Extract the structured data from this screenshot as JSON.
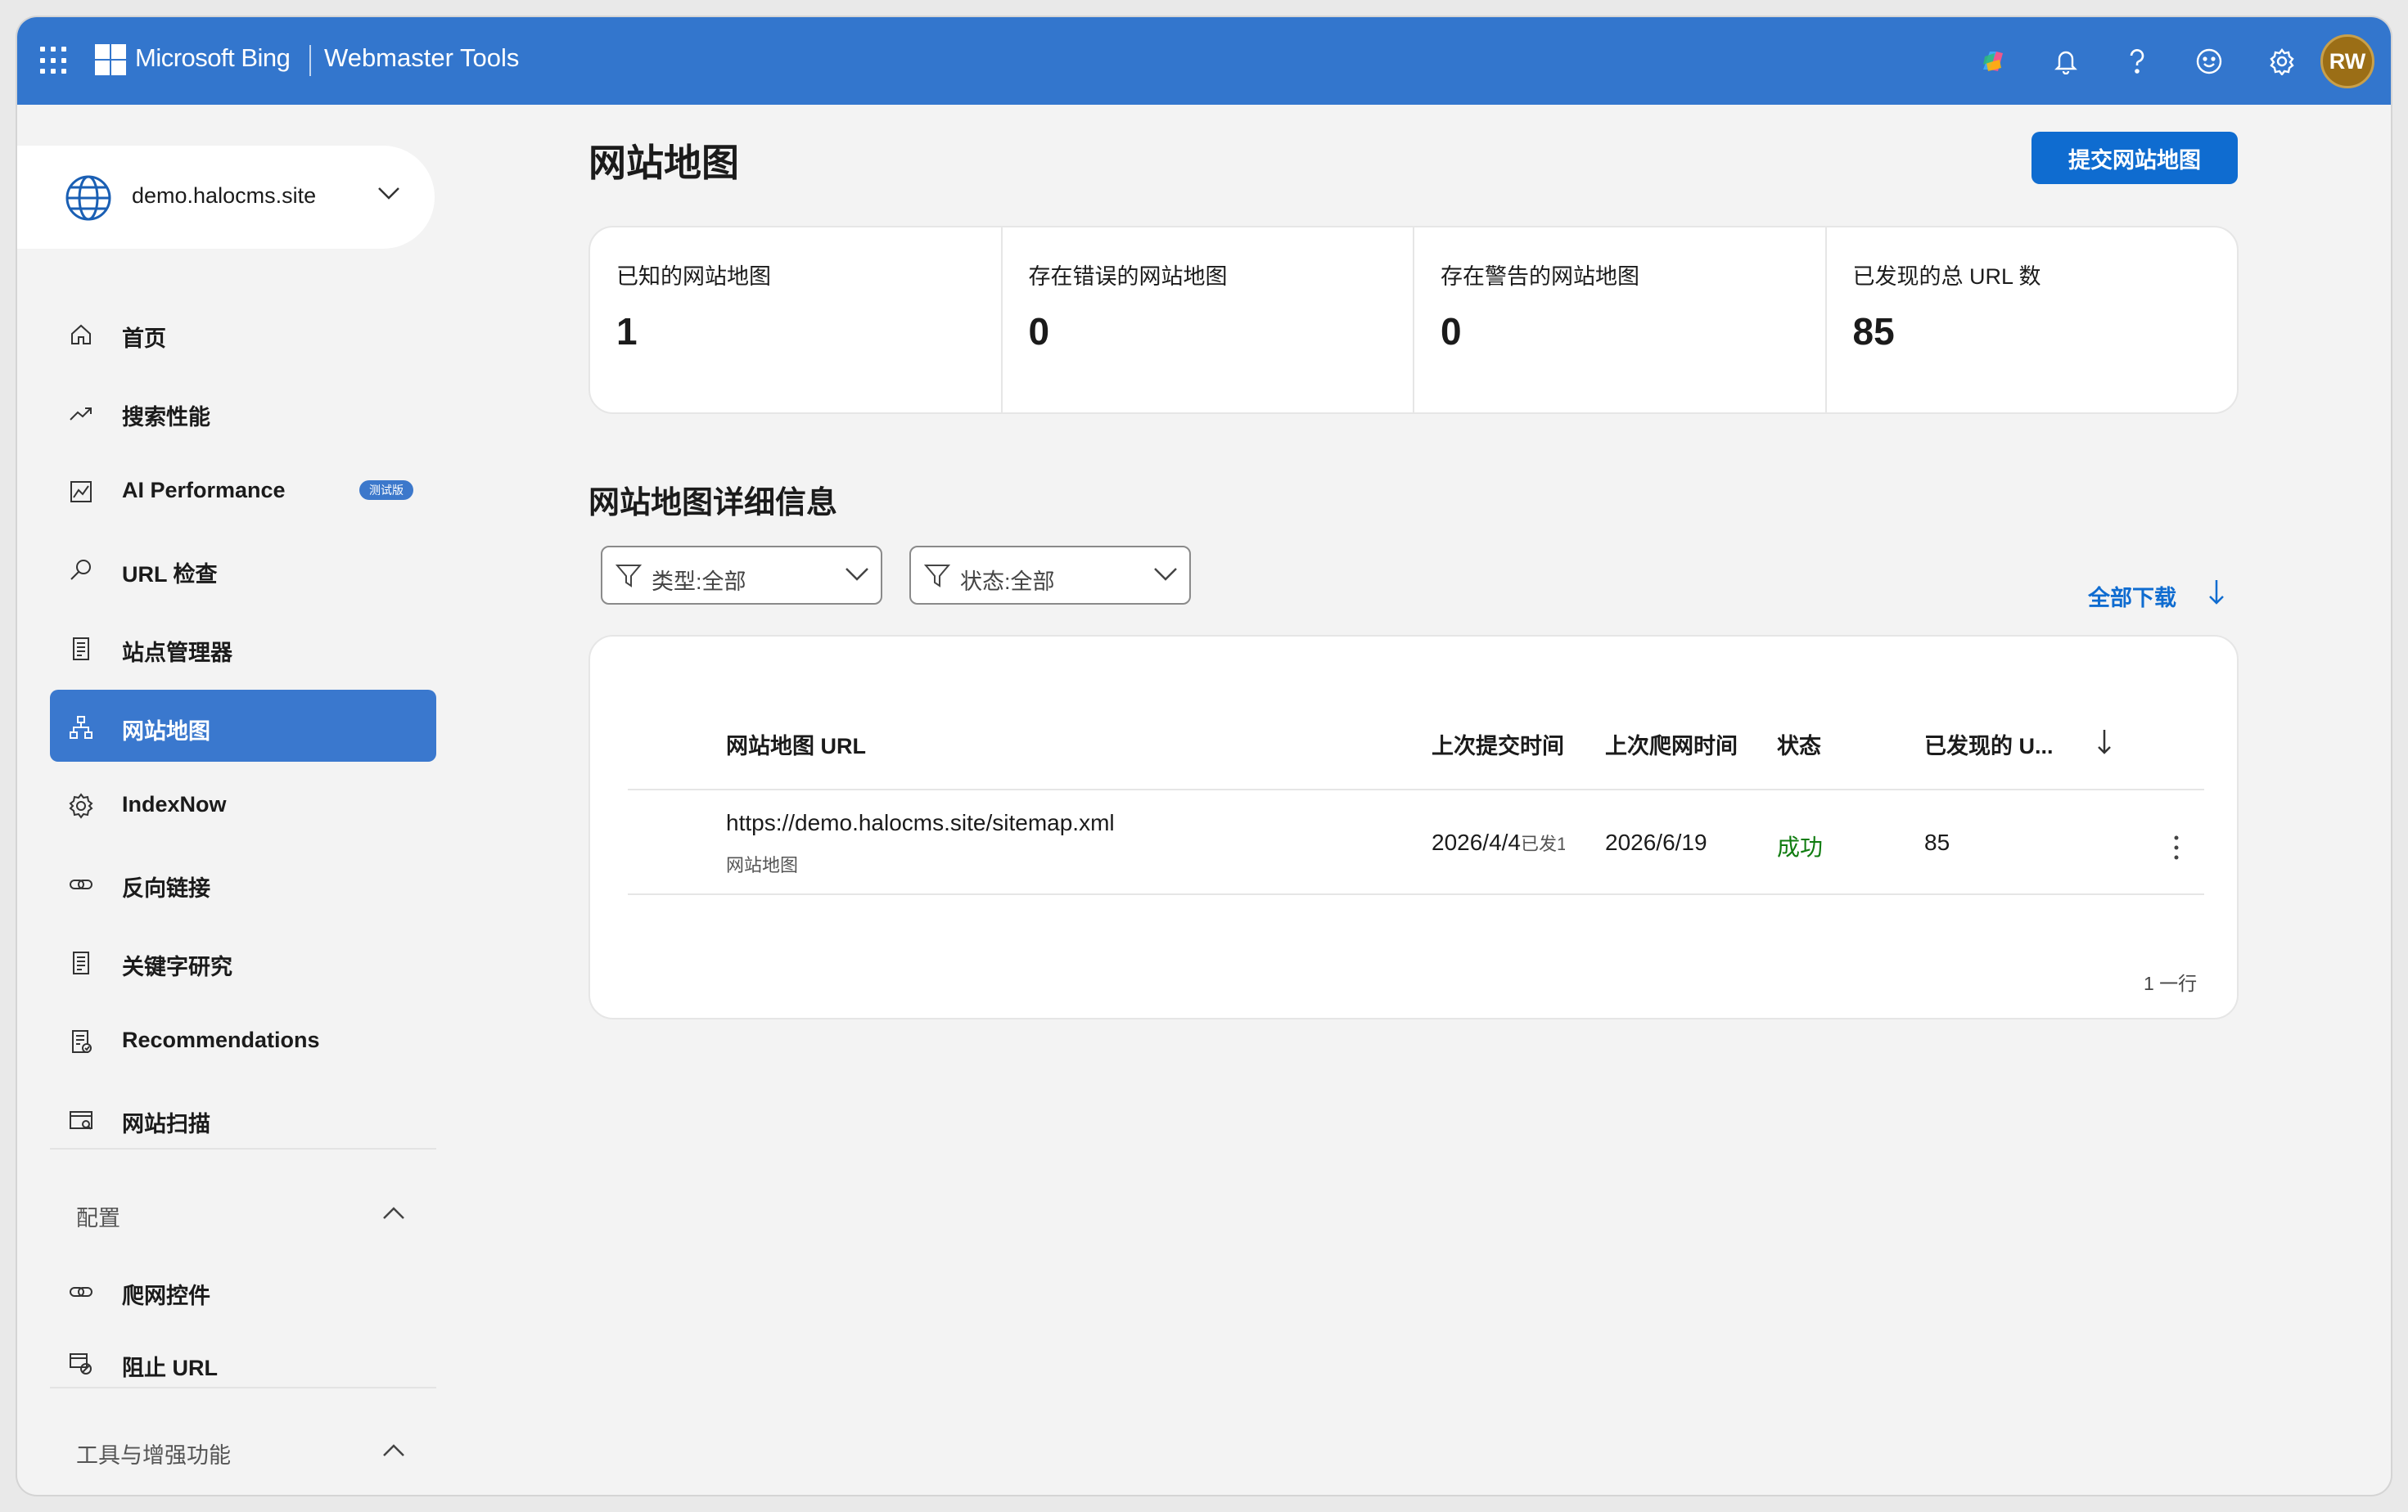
{
  "topbar": {
    "brand": "Microsoft Bing",
    "product": "Webmaster Tools",
    "avatar_initials": "RW",
    "icons": [
      "apps-waffle-icon",
      "copilot-icon",
      "bell-icon",
      "help-icon",
      "smiley-feedback-icon",
      "settings-gear-icon"
    ],
    "colors": {
      "bar": "#3376cd",
      "avatar": "#9b6e16"
    }
  },
  "site": {
    "name": "demo.halocms.site"
  },
  "nav": {
    "items": [
      {
        "label": "首页",
        "icon": "home-icon"
      },
      {
        "label": "搜索性能",
        "icon": "trend-icon"
      },
      {
        "label": "AI Performance",
        "icon": "chart-icon",
        "badge": "测试版"
      },
      {
        "label": "URL 检查",
        "icon": "search-icon"
      },
      {
        "label": "站点管理器",
        "icon": "document-icon"
      },
      {
        "label": "网站地图",
        "icon": "sitemap-icon",
        "active": true
      },
      {
        "label": "IndexNow",
        "icon": "gear-icon"
      },
      {
        "label": "反向链接",
        "icon": "link-icon"
      },
      {
        "label": "关键字研究",
        "icon": "document-icon"
      },
      {
        "label": "Recommendations",
        "icon": "checklist-icon"
      },
      {
        "label": "网站扫描",
        "icon": "scan-icon"
      }
    ],
    "config_section": {
      "title": "配置",
      "items": [
        {
          "label": "爬网控件",
          "icon": "link-icon"
        },
        {
          "label": "阻止 URL",
          "icon": "block-icon"
        }
      ]
    },
    "tools_section": {
      "title": "工具与增强功能"
    }
  },
  "main": {
    "title": "网站地图",
    "submit_button": "提交网站地图",
    "stats": [
      {
        "label": "已知的网站地图",
        "value": "1"
      },
      {
        "label": "存在错误的网站地图",
        "value": "0"
      },
      {
        "label": "存在警告的网站地图",
        "value": "0"
      },
      {
        "label": "已发现的总 URL 数",
        "value": "85"
      }
    ],
    "details_title": "网站地图详细信息",
    "filters": [
      {
        "label": "类型:全部"
      },
      {
        "label": "状态:全部"
      }
    ],
    "download_all": "全部下载",
    "table": {
      "headers": [
        "网站地图 URL",
        "上次提交时间",
        "上次爬网时间",
        "状态",
        "已发现的 U..."
      ],
      "rows": [
        {
          "url": "https://demo.halocms.site/sitemap.xml",
          "type": "网站地图",
          "submitted": "2026/4/4",
          "submitted_suffix": "已发1",
          "crawled": "2026/6/19",
          "status": "成功",
          "discovered": "85"
        }
      ],
      "row_count": "1 一行"
    },
    "colors": {
      "primary": "#0f6cd0",
      "success": "#107c10",
      "active_nav": "#3a78ce"
    }
  }
}
